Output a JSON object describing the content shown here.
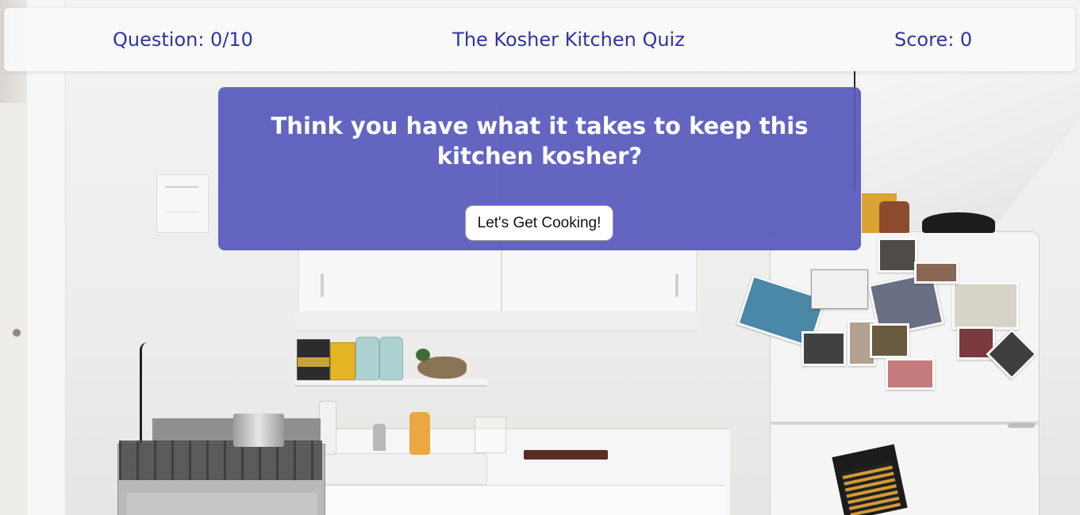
{
  "header": {
    "question_counter": "Question: 0/10",
    "title": "The Kosher Kitchen Quiz",
    "score": "Score: 0"
  },
  "intro": {
    "heading": "Think you have what it takes to keep this kitchen kosher?",
    "start_button_label": "Let's Get Cooking!"
  },
  "colors": {
    "header_text": "#32349e",
    "card_background": "#5658bc",
    "card_text": "#ffffff"
  },
  "background": {
    "image_subject": "kitchen-photo"
  }
}
